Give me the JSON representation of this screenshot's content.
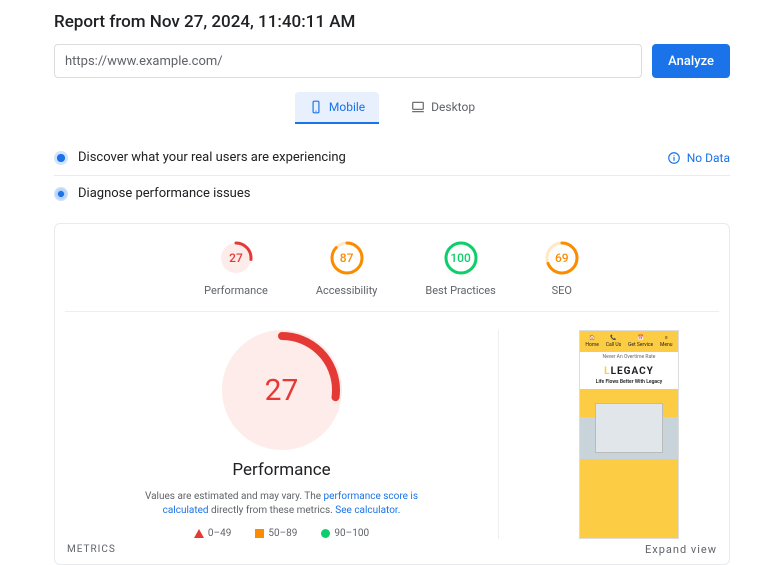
{
  "report_title": "Report from Nov 27, 2024, 11:40:11 AM",
  "url_value": "https://www.example.com/",
  "analyze_label": "Analyze",
  "tabs": {
    "mobile": "Mobile",
    "desktop": "Desktop"
  },
  "discover": {
    "title": "Discover what your real users are experiencing",
    "nodata": "No Data"
  },
  "diagnose": {
    "title": "Diagnose performance issues"
  },
  "gauges": {
    "performance": {
      "label": "Performance",
      "value": "27"
    },
    "accessibility": {
      "label": "Accessibility",
      "value": "87"
    },
    "best": {
      "label": "Best Practices",
      "value": "100"
    },
    "seo": {
      "label": "SEO",
      "value": "69"
    }
  },
  "detail": {
    "score": "27",
    "heading": "Performance",
    "disclaimer_pre": "Values are estimated and may vary. The ",
    "link1": "performance score is calculated",
    "disclaimer_mid": " directly from these metrics. ",
    "link2": "See calculator.",
    "legend": {
      "range1": "0–49",
      "range2": "50–89",
      "range3": "90–100"
    }
  },
  "preview": {
    "nav": {
      "home": "Home",
      "call": "Call Us",
      "service": "Get Service",
      "menu": "Menu"
    },
    "banner": "Never An Overtime Rate",
    "logo": "LEGACY",
    "tagline": "Life Flows Better With Legacy"
  },
  "footer": {
    "metrics": "METRICS",
    "expand": "Expand view"
  }
}
